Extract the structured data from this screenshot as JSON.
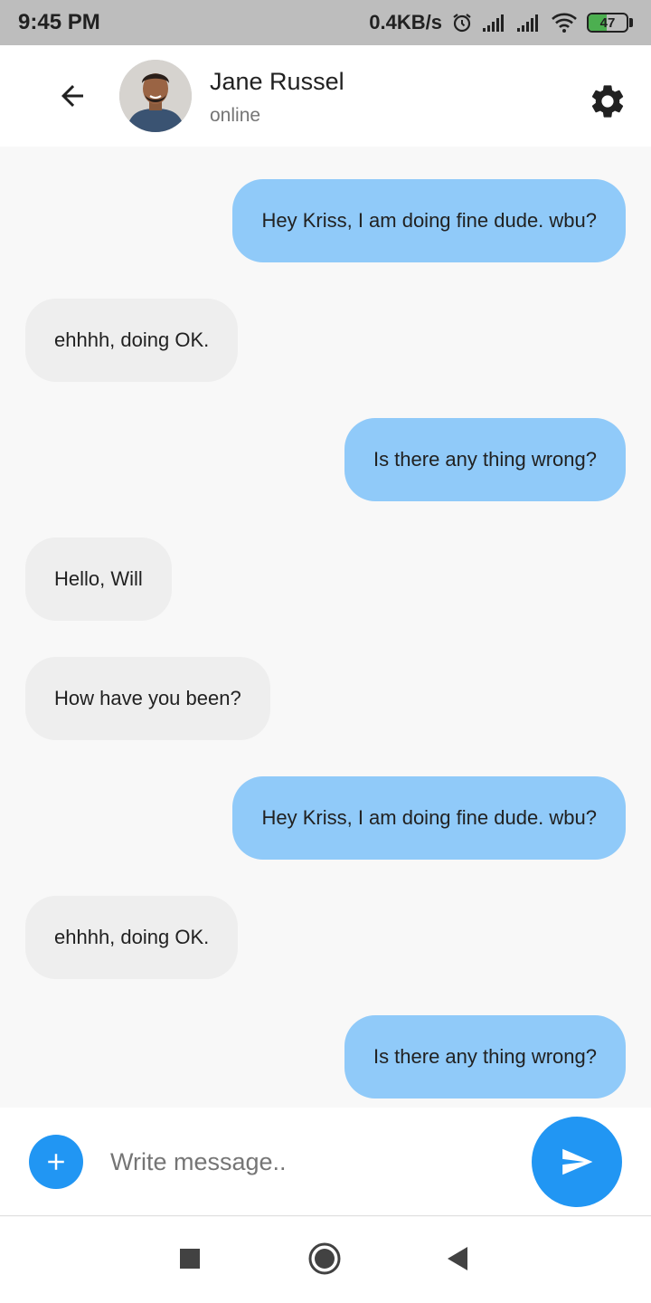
{
  "status_bar": {
    "time": "9:45 PM",
    "network_speed": "0.4KB/s",
    "battery_level": "47",
    "battery_fraction": 0.47,
    "icons": [
      "alarm-icon",
      "signal-icon",
      "signal-icon",
      "wifi-icon",
      "battery-icon"
    ]
  },
  "header": {
    "contact_name": "Jane Russel",
    "contact_status": "online",
    "icons": [
      "back-arrow-icon",
      "settings-gear-icon"
    ]
  },
  "messages": [
    {
      "text": "Hey Kriss, I am doing fine dude. wbu?",
      "direction": "sent"
    },
    {
      "text": "ehhhh, doing OK.",
      "direction": "received"
    },
    {
      "text": "Is there any thing wrong?",
      "direction": "sent"
    },
    {
      "text": "Hello, Will",
      "direction": "received"
    },
    {
      "text": "How have you been?",
      "direction": "received"
    },
    {
      "text": "Hey Kriss, I am doing fine dude. wbu?",
      "direction": "sent"
    },
    {
      "text": "ehhhh, doing OK.",
      "direction": "received"
    },
    {
      "text": "Is there any thing wrong?",
      "direction": "sent"
    }
  ],
  "composer": {
    "placeholder": "Write message..",
    "icons": [
      "add-icon",
      "send-icon"
    ]
  },
  "nav_bar": {
    "icons": [
      "recents-square-icon",
      "home-circle-icon",
      "back-triangle-icon"
    ]
  },
  "colors": {
    "sent_bubble": "#90caf9",
    "received_bubble": "#eeeeee",
    "accent": "#2196f3",
    "status_bar": "#bdbdbd",
    "battery": "#4caf50"
  }
}
